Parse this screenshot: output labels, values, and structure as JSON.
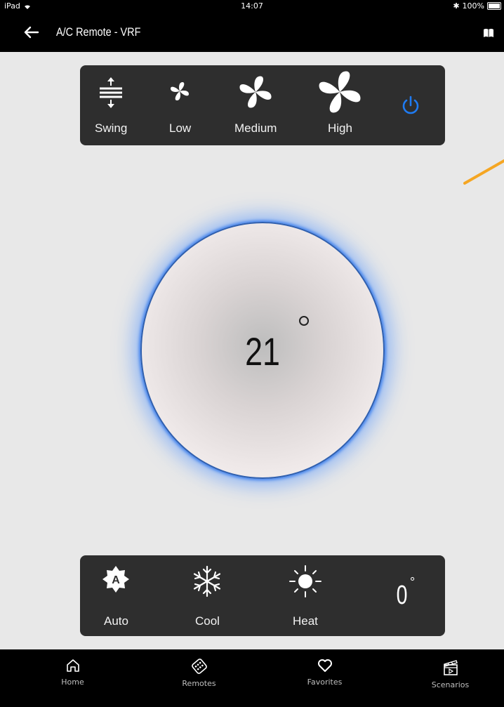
{
  "status_bar": {
    "device": "iPad",
    "time": "14:07",
    "battery": "100%"
  },
  "nav": {
    "title": "A/C Remote - VRF"
  },
  "fan_panel": {
    "buttons": [
      {
        "id": "swing",
        "label": "Swing",
        "icon": "swing-icon"
      },
      {
        "id": "low",
        "label": "Low",
        "icon": "fan-low-icon"
      },
      {
        "id": "medium",
        "label": "Medium",
        "icon": "fan-medium-icon"
      },
      {
        "id": "high",
        "label": "High",
        "icon": "fan-high-icon"
      },
      {
        "id": "power",
        "label": "",
        "icon": "power-icon"
      }
    ]
  },
  "dial": {
    "temperature": "21",
    "unit_symbol": "°"
  },
  "mode_panel": {
    "buttons": [
      {
        "id": "auto",
        "label": "Auto",
        "icon": "auto-mode-icon"
      },
      {
        "id": "cool",
        "label": "Cool",
        "icon": "snowflake-icon"
      },
      {
        "id": "heat",
        "label": "Heat",
        "icon": "sun-icon"
      }
    ],
    "degree_value": "0",
    "degree_symbol": "°"
  },
  "tabs": [
    {
      "label": "Home",
      "icon": "home-icon"
    },
    {
      "label": "Remotes",
      "icon": "remote-icon"
    },
    {
      "label": "Favorites",
      "icon": "heart-icon"
    },
    {
      "label": "Scenarios",
      "icon": "clapperboard-icon"
    }
  ],
  "colors": {
    "accent": "#1f7bf2",
    "panel": "#2e2e2e",
    "glow": "#4a8cff",
    "orange": "#f5a623"
  }
}
